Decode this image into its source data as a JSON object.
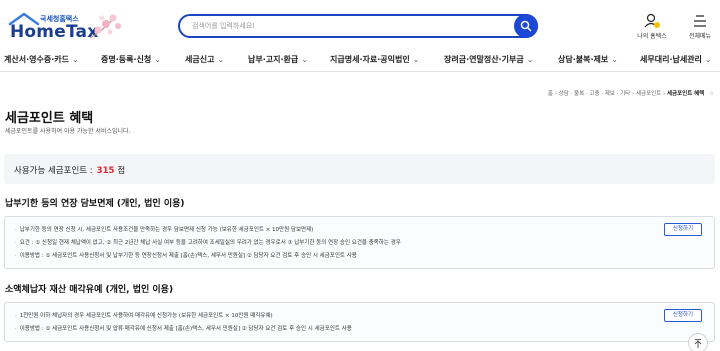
{
  "header": {
    "logo_sub": "국세청홈택스",
    "logo_main": "HomeTax",
    "search_placeholder": "검색어를 입력하세요!",
    "my_hometax": "나의 홈택스",
    "all_menu": "전체메뉴"
  },
  "nav": {
    "items": [
      "계산서·영수증·카드",
      "증명·등록·신청",
      "세금신고",
      "납부·고지·환급",
      "지급명세·자료·공익법인",
      "장려금·연말정산·기부금",
      "상담·불복·제보",
      "세무대리·납세관리"
    ]
  },
  "breadcrumb": {
    "items": [
      "홈",
      "상담 · 불복 · 고충 · 제보 · 기타",
      "세금포인트"
    ],
    "current": "세금포인트 혜택"
  },
  "page": {
    "title": "세금포인트 혜택",
    "description": "세금포인트를 사용하여 이용 가능한 서비스입니다."
  },
  "points": {
    "label": "사용가능 세금포인트 :",
    "value": "315",
    "unit": "점"
  },
  "sections": [
    {
      "title": "납부기한 등의 연장 담보면제 (개인, 법인 이용)",
      "bullets": [
        "납부기한 등의 연장 신청 시, 세금포인트 사용조건을 만족하는 경우 담보면제 신청 가능 (보유한 세금포인트 × 10만원 담보면제)",
        "요건 : ① 신청일 현재 체납액이 없고, ② 최근 2년간 체납 사실 여부 등을 고려하여 조세일실의 우려가 없는 경우로서 ③ 납부기한 등의 연장 승인 요건을 충족하는 경우",
        "이용방법 : ① 세금포인트 사용신청서 및 납부기한 등 연장신청서 제출 [홈(손)택스, 세무서 민원실] ② 담당자 요건 검토 후 승인 시 세금포인트 사용"
      ],
      "button": "신청하기"
    },
    {
      "title": "소액체납자 재산 매각유예 (개인, 법인 이용)",
      "bullets": [
        "1천만원 이하 체납자의 경우 세금포인트 사용하여 매각유예 신청가능 (보유한 세금포인트 × 10만원 매각유예)",
        "이용방법 : ① 세금포인트 사용신청서 및 압류·매각유예 신청서 제출 [홈(손)택스, 세무서 민원실] ② 담당자 요건 검토 후 승인 시 세금포인트 사용"
      ],
      "button": "신청하기"
    }
  ],
  "colors": {
    "brand": "#1b3f8f",
    "accent": "#1d48d6",
    "points": "#e02828"
  }
}
